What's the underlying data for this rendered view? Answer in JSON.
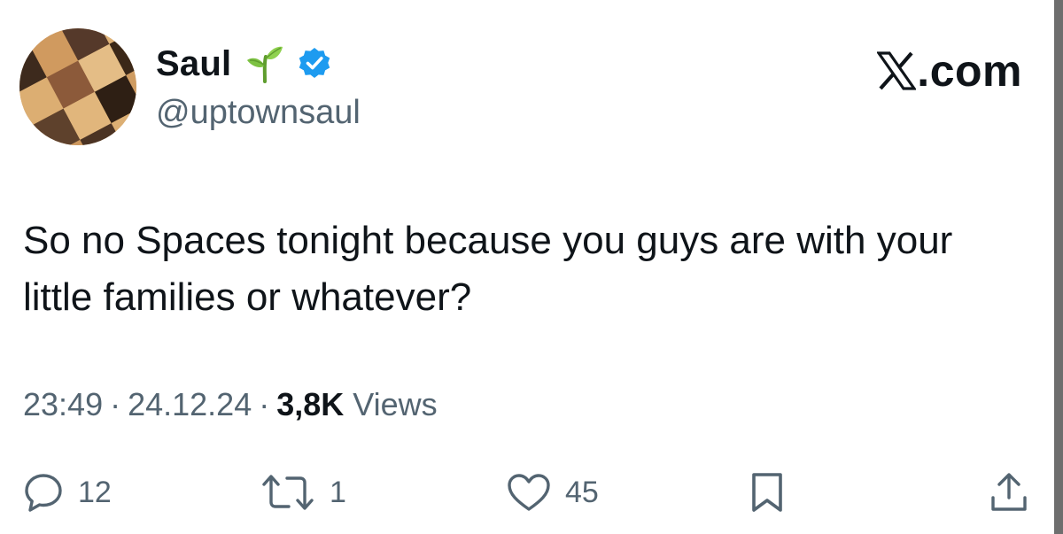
{
  "author": {
    "display_name": "Saul",
    "handle": "@uptownsaul",
    "emoji_icon": "seedling-icon",
    "verified_icon": "verified-badge-icon"
  },
  "brand": {
    "icon": "x-logo-icon",
    "suffix": ".com"
  },
  "tweet": {
    "text": "So no Spaces tonight because you guys are with your little families or whatever?"
  },
  "meta": {
    "time": "23:49",
    "separator": "·",
    "date": "24.12.24",
    "views_count": "3,8K",
    "views_label": "Views"
  },
  "actions": {
    "reply": {
      "icon": "reply-icon",
      "count": "12"
    },
    "repost": {
      "icon": "repost-icon",
      "count": "1"
    },
    "like": {
      "icon": "heart-icon",
      "count": "45"
    },
    "bookmark": {
      "icon": "bookmark-icon"
    },
    "share": {
      "icon": "share-icon"
    }
  },
  "colors": {
    "text_primary": "#0f1419",
    "text_secondary": "#536471",
    "verified_blue": "#1d9bf0",
    "sprout_green": "#7dc242"
  }
}
